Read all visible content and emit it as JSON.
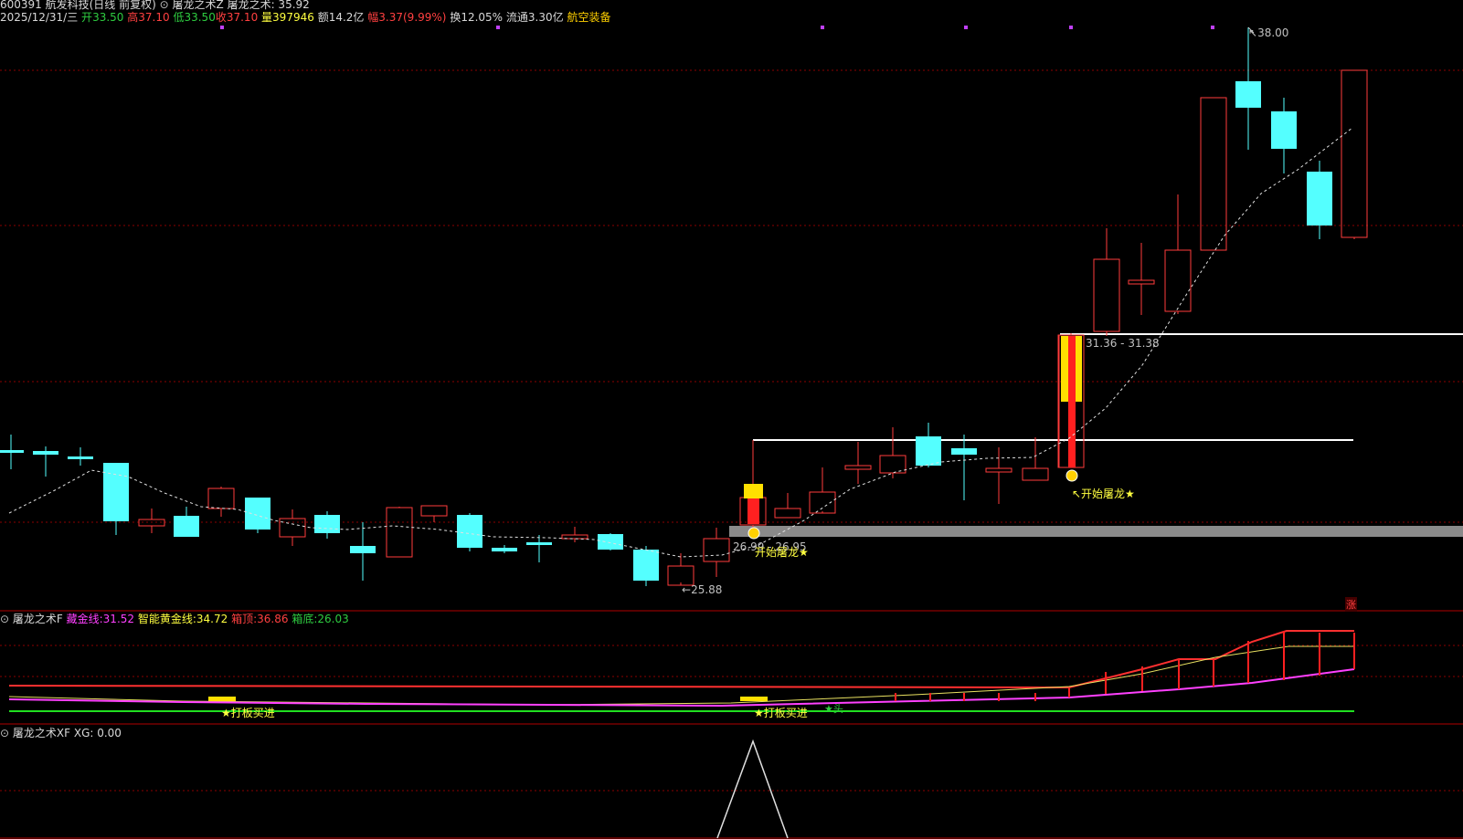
{
  "header": {
    "code_name": "600391 航发科技(日线 前复权)",
    "indicator": "屠龙之术Z",
    "indicator_value_label": "屠龙之术: 35.92",
    "date": "2025/12/31/三",
    "open_label": "开",
    "open": "33.50",
    "high_label": "高",
    "high": "37.10",
    "low_label": "低",
    "low": "33.50",
    "close_label": "收",
    "close": "37.10",
    "volume_label": "量",
    "volume": "397946",
    "amount_label": "额",
    "amount": "14.2亿",
    "range_label": "幅",
    "range": "3.37(9.99%)",
    "turnover": "换12.05%",
    "float": "流通3.30亿",
    "sector": "航空装备"
  },
  "main_chart": {
    "annotations": {
      "high_label": "38.00",
      "low_label": "25.88",
      "zone1_label": "26.99 - 26.95",
      "zone2_label": "31.36 - 31.38",
      "signal1": "开始屠龙★",
      "signal2": "↖开始屠龙★"
    }
  },
  "panel_f": {
    "title": "屠龙之术F",
    "line1_label": "藏金线:",
    "line1_value": "31.52",
    "line2_label": "智能黄金线:",
    "line2_value": "34.72",
    "line3_label": "箱顶:",
    "line3_value": "36.86",
    "line4_label": "箱底:",
    "line4_value": "26.03",
    "signal_a": "★打板买进",
    "signal_b": "★打板买进",
    "signal_c": "★头",
    "zhang_badge": "涨"
  },
  "panel_xf": {
    "title": "屠龙之术XF",
    "xg_label": "XG: 0.00"
  },
  "colors": {
    "up": "#ff3c3c",
    "down": "#54ffff",
    "ma": "#e0e0e0",
    "grid": "#8b0000",
    "yellow": "#ffe000",
    "magenta": "#ff40ff",
    "green": "#20e020"
  }
}
